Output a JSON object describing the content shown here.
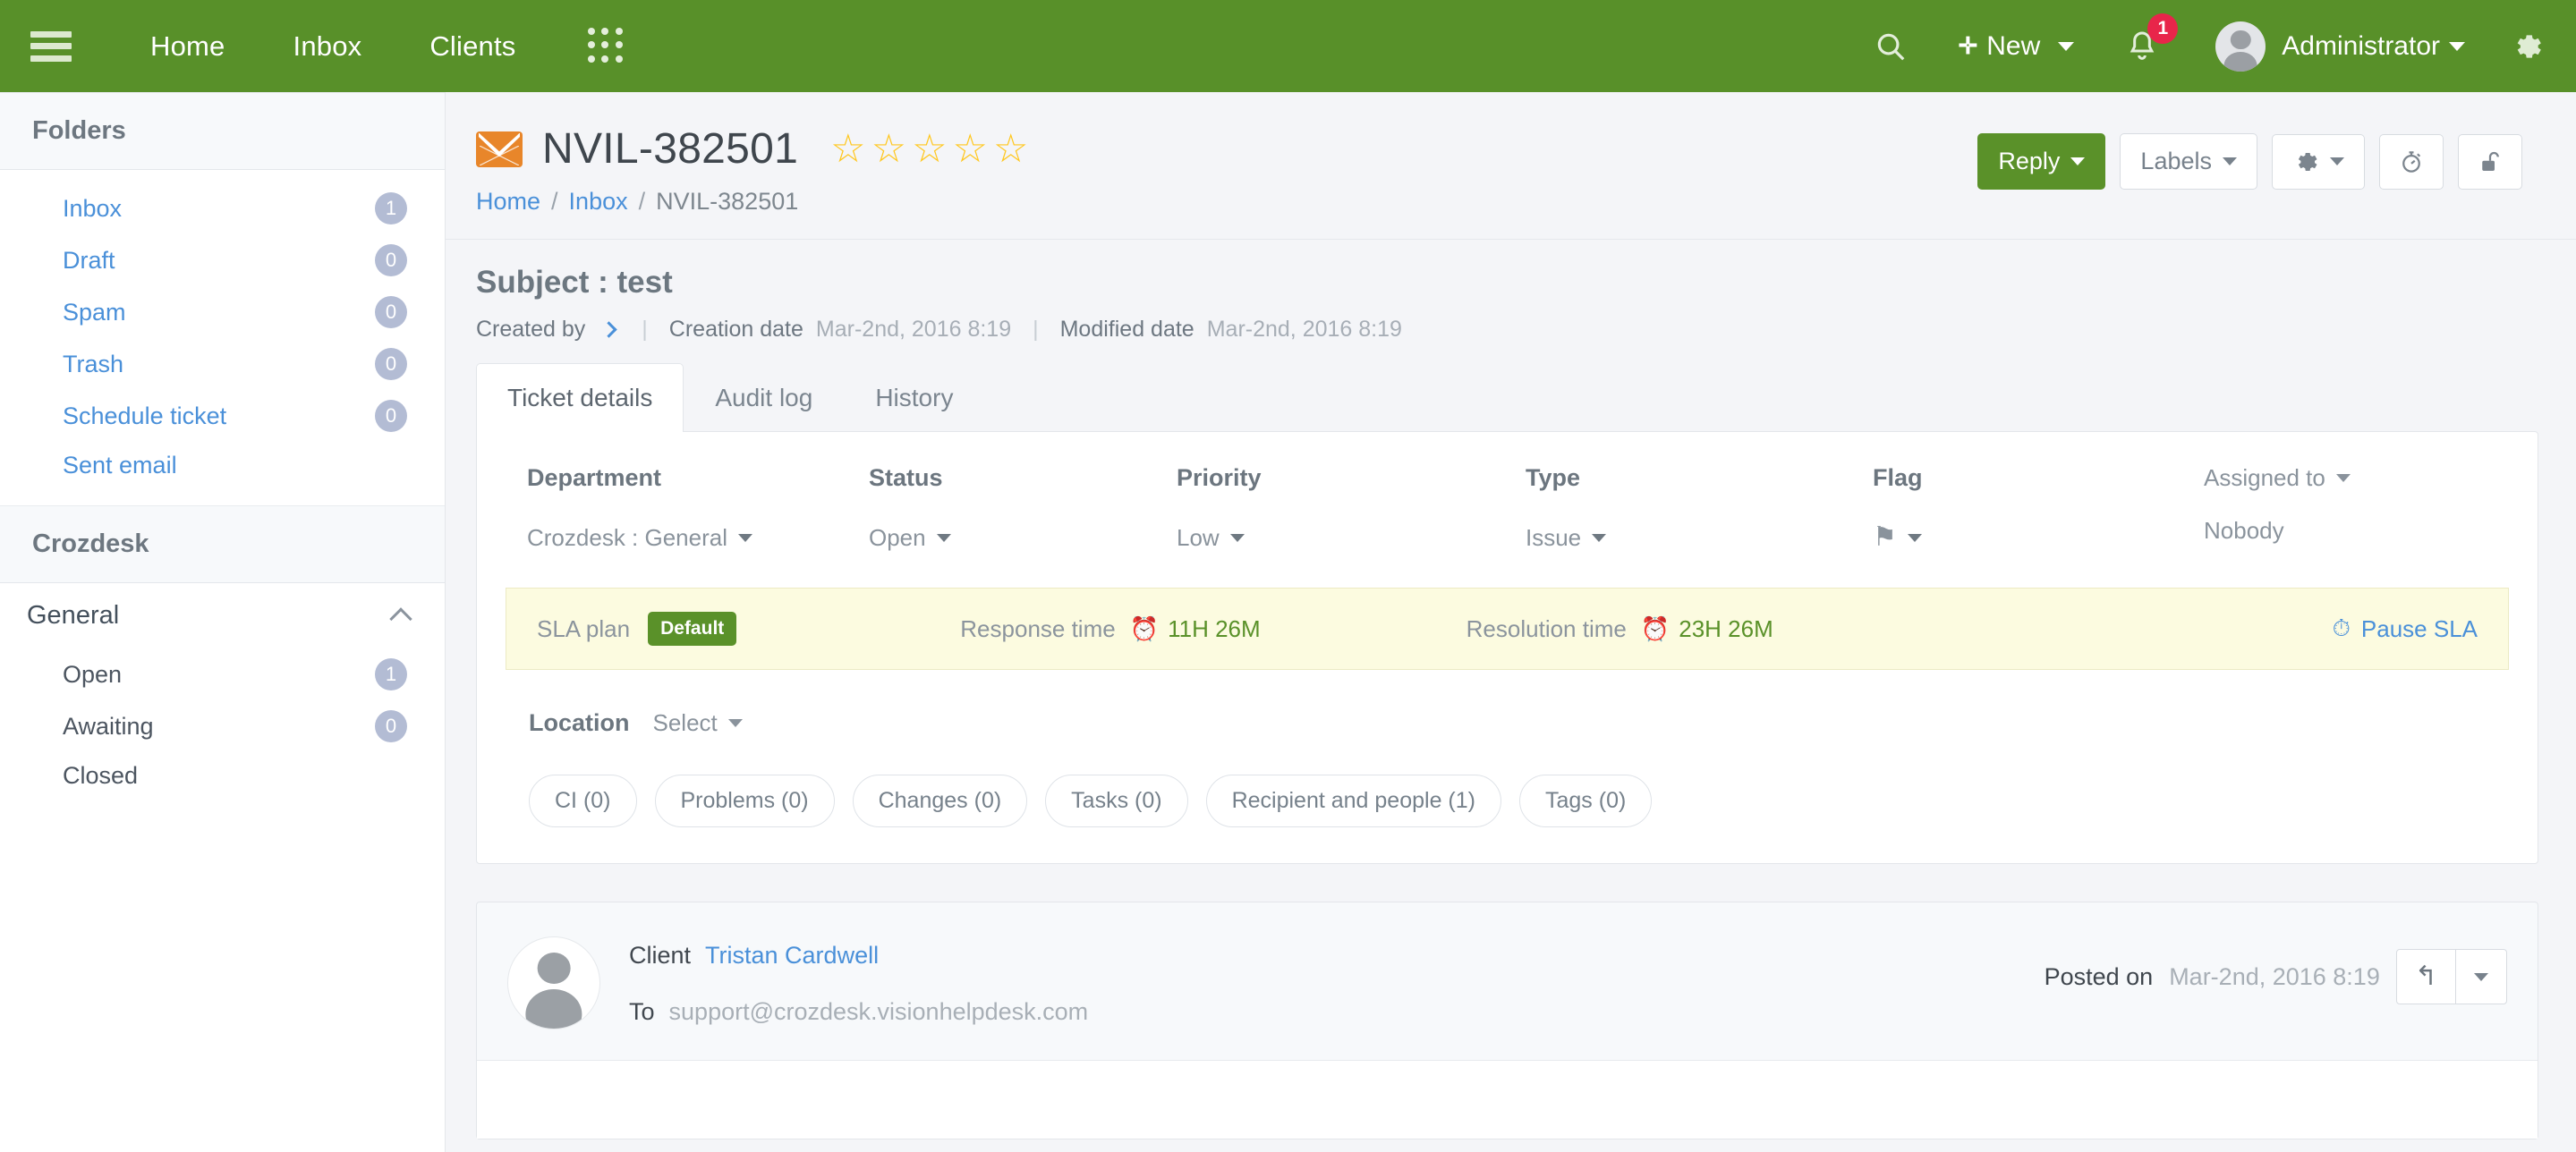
{
  "topbar": {
    "menu_icon": "hamburger-icon",
    "nav": [
      {
        "label": "Home"
      },
      {
        "label": "Inbox"
      },
      {
        "label": "Clients"
      }
    ],
    "apps_icon": "grid-apps-icon",
    "search_icon": "search-icon",
    "new_label": "New",
    "new_plus": "✛",
    "notification_icon": "bell-icon",
    "notification_count": "1",
    "user_name": "Administrator",
    "settings_icon": "gear-icon",
    "brand_color": "#589029",
    "badge_color": "#e8254a"
  },
  "sidebar": {
    "folders_title": "Folders",
    "folders": [
      {
        "label": "Inbox",
        "count": "1"
      },
      {
        "label": "Draft",
        "count": "0"
      },
      {
        "label": "Spam",
        "count": "0"
      },
      {
        "label": "Trash",
        "count": "0"
      },
      {
        "label": "Schedule ticket",
        "count": "0"
      },
      {
        "label": "Sent email",
        "count": ""
      }
    ],
    "crozdesk_title": "Crozdesk",
    "group_label": "General",
    "group_items": [
      {
        "label": "Open",
        "count": "1"
      },
      {
        "label": "Awaiting",
        "count": "0"
      },
      {
        "label": "Closed",
        "count": ""
      }
    ]
  },
  "ticket": {
    "mail_icon": "envelope-icon",
    "id": "NVIL-382501",
    "rating": 0,
    "rating_max": 5,
    "star_glyph": "☆",
    "star_color": "#ffc71f",
    "breadcrumb": [
      {
        "label": "Home",
        "link": true
      },
      {
        "label": "Inbox",
        "link": true
      },
      {
        "label": "NVIL-382501",
        "link": false
      }
    ],
    "breadcrumb_sep": "/",
    "actions": {
      "reply": "Reply",
      "labels": "Labels",
      "settings_icon": "gear-icon",
      "timer_icon": "stopwatch-icon",
      "lock_icon": "unlock-icon"
    },
    "subject": "Subject : test",
    "meta": {
      "created_by_label": "Created by",
      "created_by_value": "",
      "creation_date_label": "Creation date",
      "creation_date_value": "Mar-2nd, 2016 8:19",
      "modified_date_label": "Modified date",
      "modified_date_value": "Mar-2nd, 2016 8:19"
    },
    "tabs": [
      {
        "label": "Ticket details",
        "active": true
      },
      {
        "label": "Audit log",
        "active": false
      },
      {
        "label": "History",
        "active": false
      }
    ],
    "fields": {
      "department_label": "Department",
      "department_value": "Crozdesk : General",
      "status_label": "Status",
      "status_value": "Open",
      "priority_label": "Priority",
      "priority_value": "Low",
      "type_label": "Type",
      "type_value": "Issue",
      "flag_label": "Flag",
      "flag_value": "⚑",
      "assigned_label": "Assigned to",
      "assigned_value": "Nobody"
    },
    "sla": {
      "plan_label": "SLA plan",
      "plan_tag": "Default",
      "response_label": "Response time",
      "response_value": "11H 26M",
      "resolution_label": "Resolution time",
      "resolution_value": "23H 26M",
      "pause_label": "Pause SLA",
      "clock_glyph": "⏰",
      "pause_glyph": "⏱",
      "time_color": "#5a9129",
      "background": "#fcfbe0"
    },
    "location": {
      "label": "Location",
      "value": "Select"
    },
    "pills": [
      {
        "label": "CI (0)"
      },
      {
        "label": "Problems (0)"
      },
      {
        "label": "Changes (0)"
      },
      {
        "label": "Tasks (0)"
      },
      {
        "label": "Recipient and people (1)"
      },
      {
        "label": "Tags (0)"
      }
    ],
    "message": {
      "client_label": "Client",
      "client_name": "Tristan Cardwell",
      "to_label": "To",
      "to_value": "support@crozdesk.visionhelpdesk.com",
      "posted_label": "Posted on",
      "posted_value": "Mar-2nd, 2016 8:19",
      "reply_icon": "reply-arrow-icon",
      "reply_glyph": "↰",
      "more_icon": "chevron-down-icon"
    }
  }
}
